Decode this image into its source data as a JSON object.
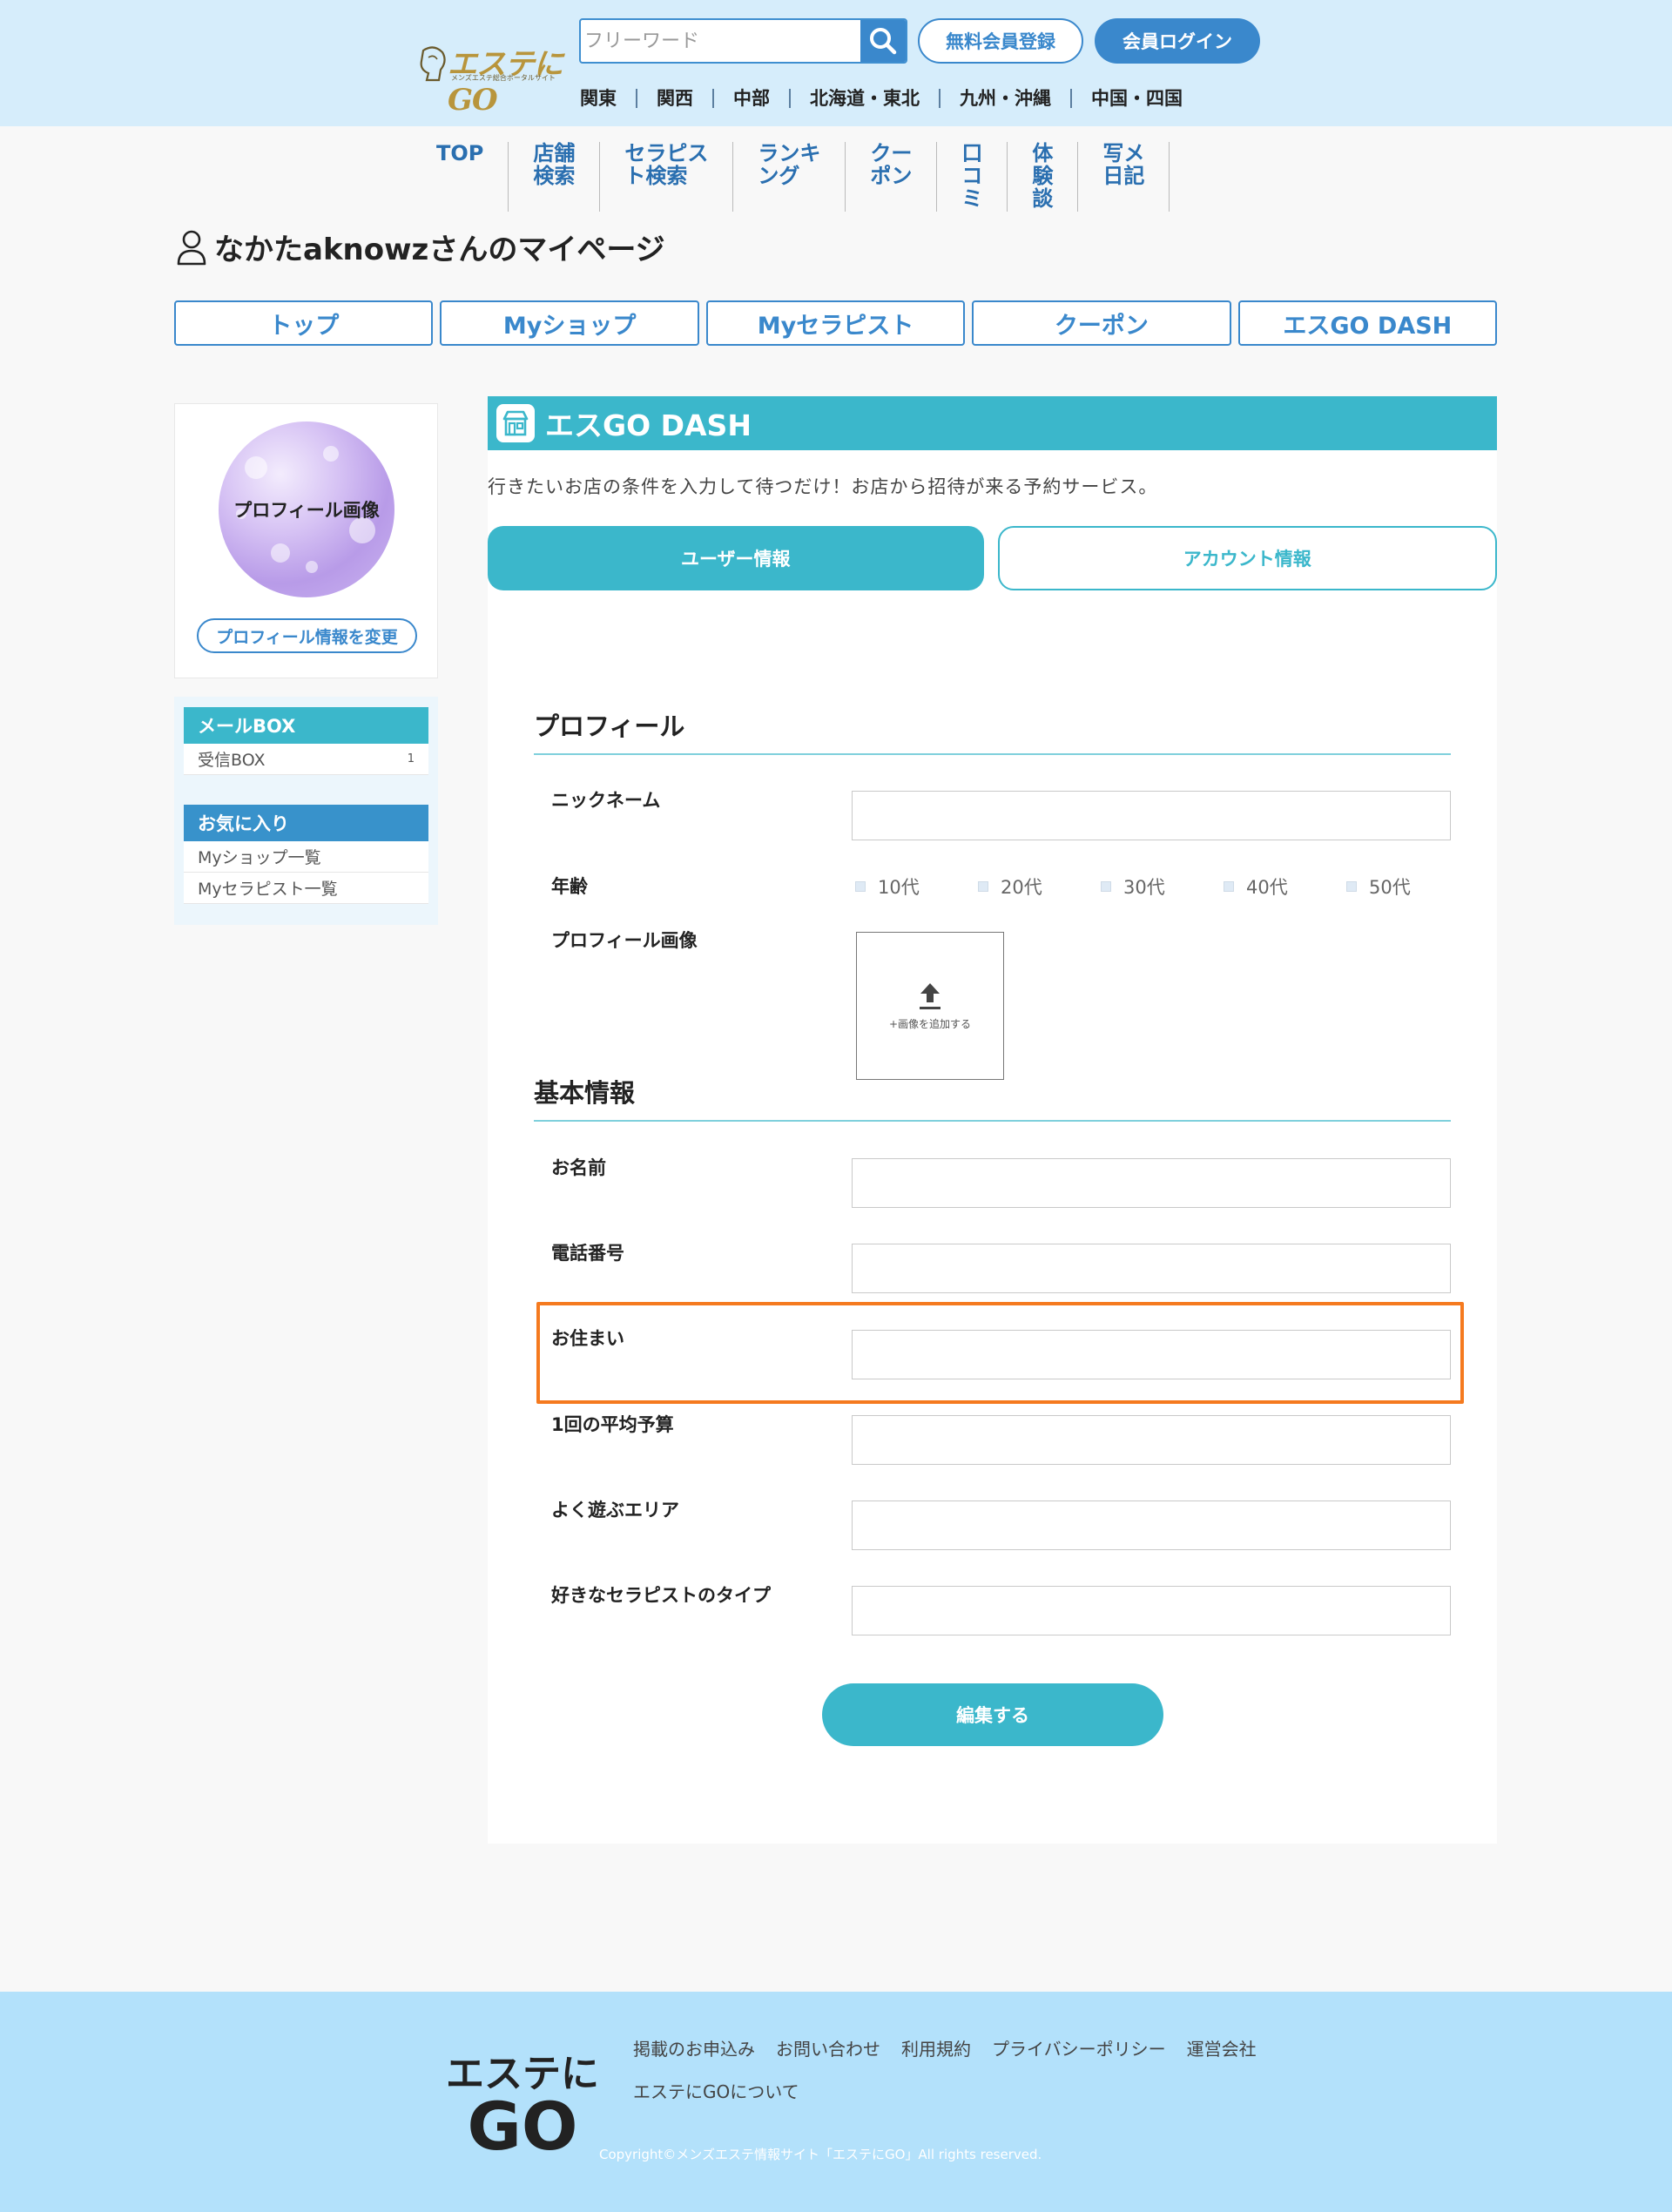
{
  "header": {
    "logo_text": "エステにGO",
    "logo_tagline": "メンズエステ総合ポータルサイト",
    "search_placeholder": "フリーワード",
    "register_label": "無料会員登録",
    "login_label": "会員ログイン",
    "regions": [
      "関東",
      "関西",
      "中部",
      "北海道・東北",
      "九州・沖縄",
      "中国・四国"
    ]
  },
  "main_nav": [
    {
      "lines": [
        "TOP"
      ]
    },
    {
      "lines": [
        "店舗",
        "検索"
      ]
    },
    {
      "lines": [
        "セラピス",
        "ト検索"
      ]
    },
    {
      "lines": [
        "ランキ",
        "ング"
      ]
    },
    {
      "lines": [
        "クー",
        "ポン"
      ]
    },
    {
      "lines": [
        "口",
        "コ",
        "ミ"
      ]
    },
    {
      "lines": [
        "体",
        "験",
        "談"
      ]
    },
    {
      "lines": [
        "写メ",
        "日記"
      ]
    }
  ],
  "page_title": "なかたaknowzさんのマイページ",
  "mypage_tabs": [
    "トップ",
    "Myショップ",
    "Myセラピスト",
    "クーポン",
    "エスGO DASH"
  ],
  "sidebar": {
    "profile_image_label": "プロフィール画像",
    "profile_edit_label": "プロフィール情報を変更",
    "mail_box": {
      "title": "メールBOX",
      "items": [
        {
          "label": "受信BOX",
          "count": "1"
        }
      ]
    },
    "favorites": {
      "title": "お気に入り",
      "items": [
        {
          "label": "Myショップ一覧"
        },
        {
          "label": "Myセラピスト一覧"
        }
      ]
    }
  },
  "panel": {
    "title": "エスGO DASH",
    "description": "行きたいお店の条件を入力して待つだけ！お店から招待が来る予約サービス。",
    "tabs": [
      "ユーザー情報",
      "アカウント情報"
    ],
    "profile_section": {
      "title": "プロフィール",
      "nickname_label": "ニックネーム",
      "nickname_value": "",
      "age_label": "年齢",
      "age_options": [
        "10代",
        "20代",
        "30代",
        "40代",
        "50代"
      ],
      "image_label": "プロフィール画像",
      "image_upload_hint": "+画像を追加する"
    },
    "basic_section": {
      "title": "基本情報",
      "fields": [
        {
          "label": "お名前",
          "value": ""
        },
        {
          "label": "電話番号",
          "value": ""
        },
        {
          "label": "お住まい",
          "value": ""
        },
        {
          "label": "1回の平均予算",
          "value": ""
        },
        {
          "label": "よく遊ぶエリア",
          "value": ""
        },
        {
          "label": "好きなセラピストのタイプ",
          "value": ""
        }
      ]
    },
    "submit_label": "編集する"
  },
  "footer": {
    "logo_line1": "エステに",
    "logo_line2": "GO",
    "links": [
      "掲載のお申込み",
      "お問い合わせ",
      "利用規約",
      "プライバシーポリシー",
      "運営会社",
      "エステにGOについて"
    ],
    "copyright": "Copyright©メンズエステ情報サイト「エステにGO」All rights reserved."
  },
  "colors": {
    "header_bg": "#d6edfb",
    "brand_blue": "#3a88cc",
    "teal": "#3bb7cb",
    "highlight": "#f57a1f",
    "footer_bg": "#b3e1fb"
  }
}
